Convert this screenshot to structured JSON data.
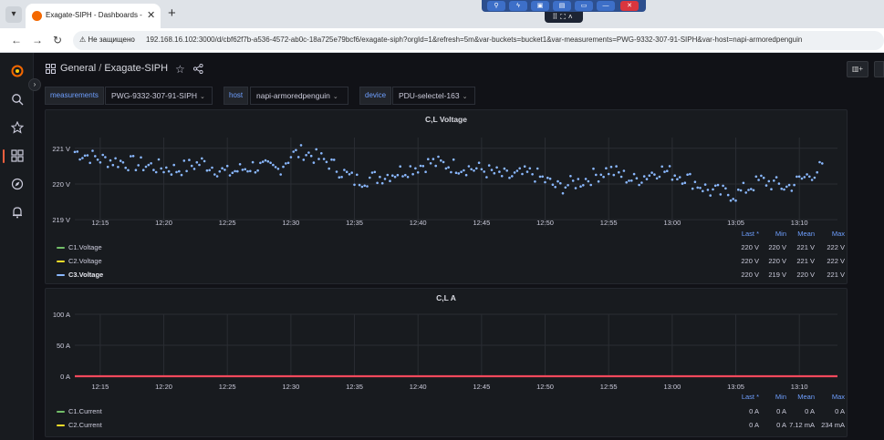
{
  "browser": {
    "tab_title": "Exagate-SIPH - Dashboards - G",
    "tab_close": "✕",
    "new_tab": "+",
    "security_label": "Не защищено",
    "url": "192.168.16.102:3000/d/cbf62f7b-a536-4572-ab0c-18a725e79bcf6/exagate-siph?orgId=1&refresh=5m&var-buckets=bucket1&var-measurements=PWG-9332-307-91-SIPH&var-host=napi-armoredpenguin"
  },
  "header": {
    "breadcrumb_parent": "General",
    "breadcrumb_separator": "/",
    "breadcrumb_current": "Exagate-SIPH"
  },
  "variables": [
    {
      "label": "measurements",
      "value": "PWG-9332-307-91-SIPH"
    },
    {
      "label": "host",
      "value": "napi-armoredpenguin"
    },
    {
      "label": "device",
      "value": "PDU-selectel-163"
    }
  ],
  "x_ticks": [
    "12:15",
    "12:20",
    "12:25",
    "12:30",
    "12:35",
    "12:40",
    "12:45",
    "12:50",
    "12:55",
    "13:00",
    "13:05",
    "13:10"
  ],
  "colors": {
    "c1": "#73bf69",
    "c2": "#fade2a",
    "c3": "#8ab8ff",
    "current_line": "#f2495c",
    "accent": "#6e9fff",
    "grafana_logo": "#f46800"
  },
  "icons": [
    "grafana-logo",
    "search-icon",
    "star-icon",
    "dashboards-icon",
    "explore-icon",
    "alerting-icon",
    "share-icon",
    "add-panel-icon"
  ],
  "panel_voltage": {
    "title": "C,L Voltage",
    "y_ticks": [
      "221 V",
      "220 V",
      "219 V"
    ],
    "legend_headers": [
      "Last *",
      "Min",
      "Mean",
      "Max"
    ],
    "legend_rows": [
      {
        "name": "C1.Voltage",
        "last": "220 V",
        "min": "220 V",
        "mean": "221 V",
        "max": "222 V"
      },
      {
        "name": "C2.Voltage",
        "last": "220 V",
        "min": "220 V",
        "mean": "221 V",
        "max": "222 V"
      },
      {
        "name": "C3.Voltage",
        "last": "220 V",
        "min": "219 V",
        "mean": "220 V",
        "max": "221 V"
      }
    ]
  },
  "panel_current": {
    "title": "C,L A",
    "y_ticks": [
      "100 A",
      "50 A",
      "0 A"
    ],
    "legend_headers": [
      "Last *",
      "Min",
      "Mean",
      "Max"
    ],
    "legend_rows": [
      {
        "name": "C1.Current",
        "last": "0 A",
        "min": "0 A",
        "mean": "0 A",
        "max": "0 A"
      },
      {
        "name": "C2.Current",
        "last": "0 A",
        "min": "0 A",
        "mean": "7.12 mA",
        "max": "234 mA"
      }
    ]
  },
  "chart_data": [
    {
      "type": "scatter",
      "title": "C,L Voltage",
      "xlabel": "",
      "ylabel": "",
      "x_ticks": [
        "12:15",
        "12:20",
        "12:25",
        "12:30",
        "12:35",
        "12:40",
        "12:45",
        "12:50",
        "12:55",
        "13:00",
        "13:05",
        "13:10"
      ],
      "xlim": [
        "12:13",
        "13:13"
      ],
      "ylim": [
        218.8,
        221.3
      ],
      "y_unit": "V",
      "grid": true,
      "legend_placement": "bottom",
      "series": [
        {
          "name": "C3.Voltage",
          "x": [
            "12:13",
            "12:15",
            "12:17",
            "12:19",
            "12:21",
            "12:23",
            "12:25",
            "12:27",
            "12:29",
            "12:30",
            "12:31",
            "12:33",
            "12:35",
            "12:37",
            "12:39",
            "12:41",
            "12:43",
            "12:45",
            "12:47",
            "12:49",
            "12:51",
            "12:53",
            "12:55",
            "12:57",
            "12:59",
            "13:01",
            "13:03",
            "13:05",
            "13:07",
            "13:09",
            "13:11",
            "13:12"
          ],
          "values": [
            220.9,
            220.7,
            220.6,
            220.5,
            220.4,
            220.6,
            220.3,
            220.5,
            220.4,
            220.8,
            220.9,
            220.6,
            220.1,
            220.2,
            220.4,
            220.6,
            220.5,
            220.4,
            220.2,
            220.3,
            219.9,
            220.1,
            220.4,
            220.1,
            220.4,
            220.2,
            219.8,
            219.7,
            220.1,
            219.9,
            220.3,
            220.5
          ]
        }
      ]
    },
    {
      "type": "line",
      "title": "C,L A",
      "xlabel": "",
      "ylabel": "",
      "x_ticks": [
        "12:15",
        "12:20",
        "12:25",
        "12:30",
        "12:35",
        "12:40",
        "12:45",
        "12:50",
        "12:55",
        "13:00",
        "13:05",
        "13:10"
      ],
      "ylim": [
        0,
        100
      ],
      "y_unit": "A",
      "grid": true,
      "legend_placement": "bottom",
      "series": [
        {
          "name": "C1.Current",
          "values": [
            0,
            0,
            0,
            0,
            0,
            0,
            0,
            0,
            0,
            0,
            0,
            0
          ]
        },
        {
          "name": "C2.Current",
          "values": [
            0,
            0,
            0,
            0,
            0,
            0,
            0,
            0,
            0,
            0,
            0,
            0
          ]
        }
      ]
    }
  ]
}
